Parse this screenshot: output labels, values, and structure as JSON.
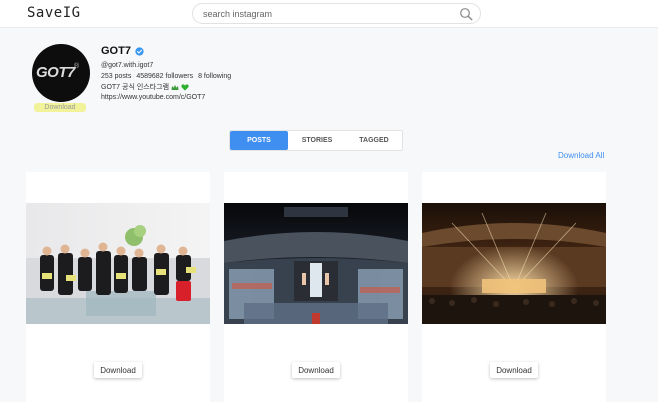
{
  "app": {
    "logo": "SaveIG"
  },
  "search": {
    "placeholder": "search instagram"
  },
  "profile": {
    "name": "GOT7",
    "avatar_text": "GOT7",
    "avatar_download": "Download",
    "handle": "@got7.with.igot7",
    "posts": "253 posts",
    "followers": "4589682 followers",
    "following": "8 following",
    "bio": "GOT7 공식 인스타그램",
    "link": "https://www.youtube.com/c/GOT7"
  },
  "tabs": [
    {
      "label": "POSTS",
      "active": true
    },
    {
      "label": "STORIES",
      "active": false
    },
    {
      "label": "TAGGED",
      "active": false
    }
  ],
  "download_all": "Download All",
  "posts": [
    {
      "photo": "group-photo-on-sofa",
      "download": "Download"
    },
    {
      "photo": "concert-stage-arena",
      "download": "Download"
    },
    {
      "photo": "concert-hall-golden-lights",
      "download": "Download"
    }
  ],
  "colors": {
    "accent": "#3f8ff0",
    "verified": "#3897f0",
    "highlight": "#f1f29a"
  }
}
